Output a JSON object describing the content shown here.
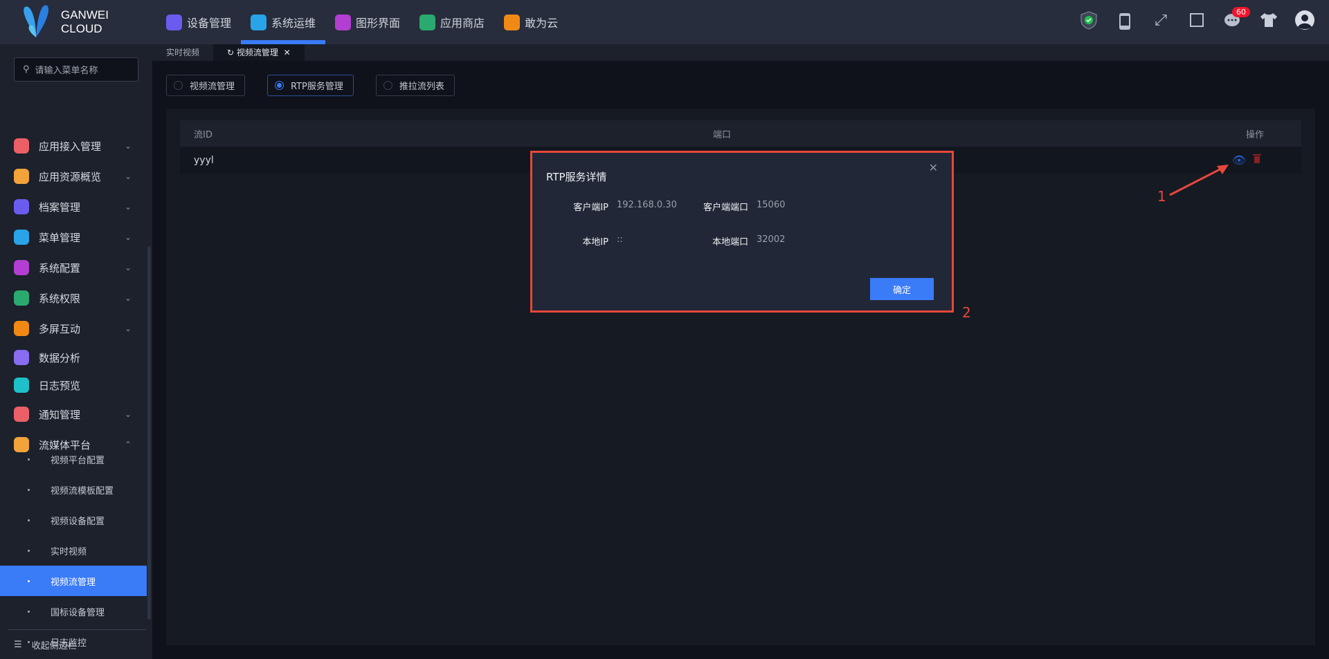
{
  "logo": {
    "line1": "GANWEI",
    "line2": "CLOUD"
  },
  "topnav": [
    {
      "label": "设备管理",
      "color": "#6b5cf0"
    },
    {
      "label": "系统运维",
      "color": "#2aa4e8",
      "active": true
    },
    {
      "label": "图形界面",
      "color": "#b23fd1"
    },
    {
      "label": "应用商店",
      "color": "#2aaa6e"
    },
    {
      "label": "敢为云",
      "color": "#f08a14"
    }
  ],
  "header_icons": [
    "shield-check-icon",
    "phone-icon",
    "fullscreen-icon",
    "frame-icon",
    "message-icon",
    "shirt-icon",
    "avatar-icon"
  ],
  "notification_count": "60",
  "tabs": [
    {
      "label": "实时视频"
    },
    {
      "label": "视频流管理",
      "close": "✕",
      "refresh": "↻"
    }
  ],
  "sidebar": {
    "search_placeholder": "请输入菜单名称",
    "items": [
      {
        "label": "应用接入管理",
        "color": "#ec5f66"
      },
      {
        "label": "应用资源概览",
        "color": "#f2a33a"
      },
      {
        "label": "档案管理",
        "color": "#6b5cf0"
      },
      {
        "label": "菜单管理",
        "color": "#2aa4e8"
      },
      {
        "label": "系统配置",
        "color": "#b23fd1"
      },
      {
        "label": "系统权限",
        "color": "#2aaa6e"
      },
      {
        "label": "多屏互动",
        "color": "#f08a14"
      },
      {
        "label": "数据分析",
        "color": "#8a6cf0"
      },
      {
        "label": "日志预览",
        "color": "#1fc0c9"
      },
      {
        "label": "通知管理",
        "color": "#ec5f66"
      },
      {
        "label": "流媒体平台",
        "color": "#f2a33a"
      }
    ],
    "subitems": [
      "视频平台配置",
      "视频流模板配置",
      "视频设备配置",
      "实时视频",
      "视频流管理",
      "国标设备管理",
      "日志监控"
    ],
    "collapse_label": "收起侧边栏"
  },
  "radios": [
    "视频流管理",
    "RTP服务管理",
    "推拉流列表"
  ],
  "table": {
    "headers": [
      "流ID",
      "端口",
      "操作"
    ],
    "rows": [
      {
        "id": "yyyl",
        "port": ""
      }
    ]
  },
  "dialog": {
    "title": "RTP服务详情",
    "fields": [
      {
        "label": "客户端IP",
        "value": "192.168.0.30"
      },
      {
        "label": "客户端端口",
        "value": "15060"
      },
      {
        "label": "本地IP",
        "value": "::"
      },
      {
        "label": "本地端口",
        "value": "32002"
      }
    ],
    "ok_label": "确定",
    "close": "✕"
  },
  "annotations": [
    "1",
    "2"
  ]
}
